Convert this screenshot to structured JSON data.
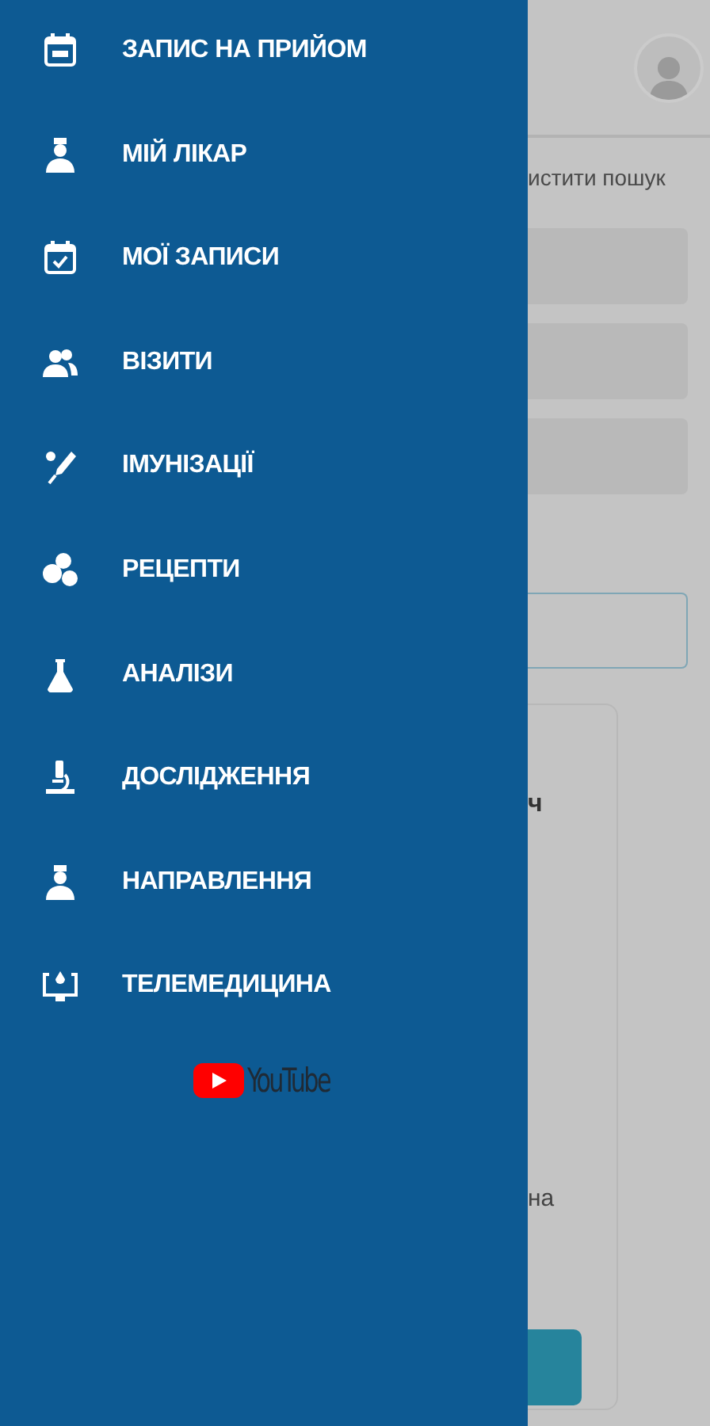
{
  "drawer": {
    "items": [
      {
        "label": "ЗАПИС НА ПРИЙОМ"
      },
      {
        "label": "МІЙ ЛІКАР"
      },
      {
        "label": "МОЇ ЗАПИСИ"
      },
      {
        "label": "ВІЗИТИ"
      },
      {
        "label": "ІМУНІЗАЦІЇ"
      },
      {
        "label": "РЕЦЕПТИ"
      },
      {
        "label": "АНАЛІЗИ"
      },
      {
        "label": "ДОСЛІДЖЕННЯ"
      },
      {
        "label": "НАПРАВЛЕННЯ"
      },
      {
        "label": "ТЕЛЕМЕДИЦИНА"
      }
    ],
    "youtube": "YouTube"
  },
  "background": {
    "search_link": "истити пошук",
    "card_text_1": "ч",
    "card_text_2": "на"
  }
}
